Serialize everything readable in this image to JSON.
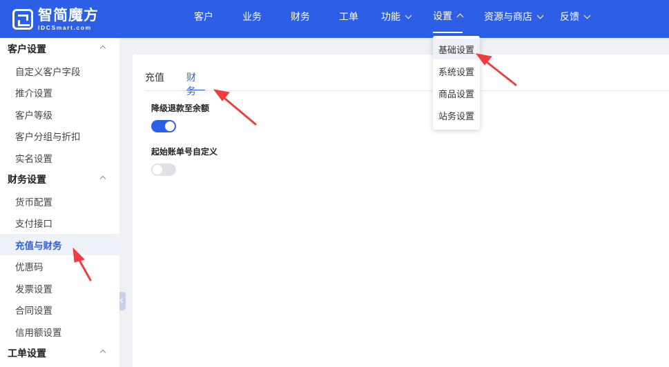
{
  "header": {
    "logo_cn": "智简魔方",
    "logo_en": "IDCSmart.com",
    "nav": [
      {
        "label": "客户"
      },
      {
        "label": "业务"
      },
      {
        "label": "财务"
      },
      {
        "label": "工单"
      },
      {
        "label": "功能"
      },
      {
        "label": "设置"
      },
      {
        "label": "资源与商店"
      },
      {
        "label": "反馈"
      }
    ]
  },
  "settings_dropdown": {
    "items": [
      {
        "label": "基础设置"
      },
      {
        "label": "系统设置"
      },
      {
        "label": "商品设置"
      },
      {
        "label": "站务设置"
      }
    ]
  },
  "sidebar": {
    "groups": [
      {
        "label": "客户设置",
        "items": [
          "自定义客户字段",
          "推介设置",
          "客户等级",
          "客户分组与折扣",
          "实名设置"
        ]
      },
      {
        "label": "财务设置",
        "items": [
          "货币配置",
          "支付接口",
          "充值与财务",
          "优惠码",
          "发票设置",
          "合同设置",
          "信用额设置"
        ]
      },
      {
        "label": "工单设置",
        "items": []
      }
    ],
    "active_item": "充值与财务"
  },
  "content": {
    "tabs": [
      {
        "label": "充值"
      },
      {
        "label": "财务"
      }
    ],
    "fields": [
      {
        "label": "降级退款至余额",
        "enabled": true
      },
      {
        "label": "起始账单号自定义",
        "enabled": false
      }
    ]
  },
  "colors": {
    "brand": "#2c5fe6",
    "annotation": "#f03c3c"
  }
}
